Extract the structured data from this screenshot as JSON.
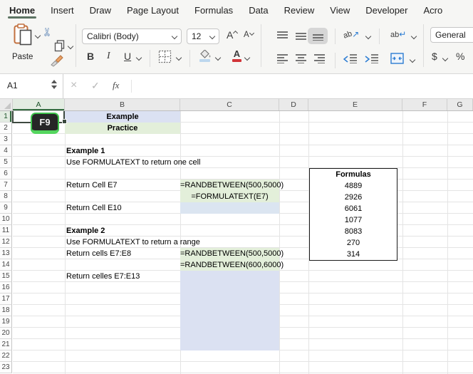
{
  "ribbon": {
    "tabs": [
      "Home",
      "Insert",
      "Draw",
      "Page Layout",
      "Formulas",
      "Data",
      "Review",
      "View",
      "Developer",
      "Acro"
    ],
    "active_tab": "Home",
    "paste_label": "Paste",
    "font_name": "Calibri (Body)",
    "font_size": "12",
    "grow_font_label": "A",
    "shrink_font_label": "A",
    "bold_label": "B",
    "italic_label": "I",
    "underline_label": "U",
    "orientation_label": "ab",
    "wrap_label": "ab",
    "font_color_label": "A",
    "number_format": "General",
    "dollar_label": "$",
    "percent_label": "%"
  },
  "formula_bar": {
    "name_box": "A1",
    "fx_label": "fx",
    "formula_value": ""
  },
  "sheet": {
    "column_headers": [
      "A",
      "B",
      "C",
      "D",
      "E",
      "F",
      "G"
    ],
    "selected_column": "A",
    "row_headers": [
      "1",
      "2",
      "3",
      "4",
      "5",
      "6",
      "7",
      "8",
      "9",
      "10",
      "11",
      "12",
      "13",
      "14",
      "15",
      "16",
      "17",
      "18",
      "19",
      "20",
      "21",
      "22",
      "23"
    ],
    "selected_row": "1",
    "keycap_label": "F9",
    "cells": {
      "b1": "Example",
      "b2": "Practice",
      "b4": "Example 1",
      "b5": "Use FORMULATEXT to return one cell",
      "b7": "Return Cell E7",
      "b9": "Return Cell E10",
      "b11": "Example 2",
      "b12": "Use FORMULATEXT to return a range",
      "b13": "Return cells E7:E8",
      "b15": "Return celles E7:E13",
      "c7": "=RANDBETWEEN(500,5000)",
      "c8": "=FORMULATEXT(E7)",
      "c13": "=RANDBETWEEN(500,5000)",
      "c14": "=RANDBETWEEN(600,6000)"
    },
    "formulas_table": {
      "header": "Formulas",
      "values": [
        "4889",
        "2926",
        "6061",
        "1077",
        "8083",
        "270",
        "314"
      ]
    },
    "colors": {
      "green_fill": "#e3efda",
      "blue_fill": "#dbe1f2",
      "keycap_green": "#3fc24c",
      "selection_border": "#3e4a40",
      "header_accent_green": "#356d41",
      "active_tab_underline": "#5c7362"
    }
  }
}
